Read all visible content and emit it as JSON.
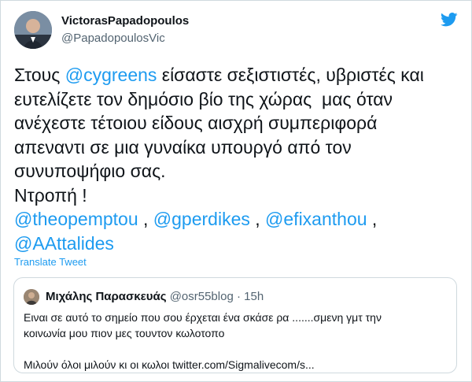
{
  "author": {
    "display_name": "VictorasPapadopoulos",
    "handle": "@PapadopoulosVic"
  },
  "tweet": {
    "lines": [
      [
        {
          "t": "Στους "
        },
        {
          "t": "@cygreens",
          "m": true
        },
        {
          "t": " είσαστε σεξιστιστές, υβριστές και"
        }
      ],
      [
        {
          "t": "ευτελίζετε τον δημόσιο βίο της χώρας  μας όταν"
        }
      ],
      [
        {
          "t": "ανέχεστε τέτοιου είδους αισχρή συμπεριφορά"
        }
      ],
      [
        {
          "t": "απεναντι σε μια γυναίκα υπουργό από τον"
        }
      ],
      [
        {
          "t": "συνυποψήφιο σας."
        }
      ],
      [
        {
          "t": "Ντροπή !"
        }
      ],
      [
        {
          "t": "@theopemptou",
          "m": true
        },
        {
          "t": " , "
        },
        {
          "t": "@gperdikes",
          "m": true
        },
        {
          "t": " , "
        },
        {
          "t": "@efixanthou",
          "m": true
        },
        {
          "t": " ,"
        }
      ],
      [
        {
          "t": "@AAttalides",
          "m": true
        }
      ]
    ],
    "translate_label": "Translate Tweet"
  },
  "quoted_tweet": {
    "display_name": "Μιχάλης Παρασκευάς",
    "handle": "@osr55blog",
    "separator": "·",
    "time": "15h",
    "lines": [
      "Ειναι σε αυτό το σημείο που σου έρχεται ένα σκάσε ρα .......σμενη γμτ την",
      "κοινωνία μου πιον μες τουντον κωλοτοπο",
      "",
      "Μιλούν όλοι μιλούν κι οι κωλοι twitter.com/Sigmalivecom/s..."
    ]
  },
  "icons": {
    "twitter": "twitter-bird-icon"
  },
  "colors": {
    "link": "#1d9bf0",
    "text": "#0f1419",
    "muted": "#536471",
    "border": "#cfd9de"
  }
}
